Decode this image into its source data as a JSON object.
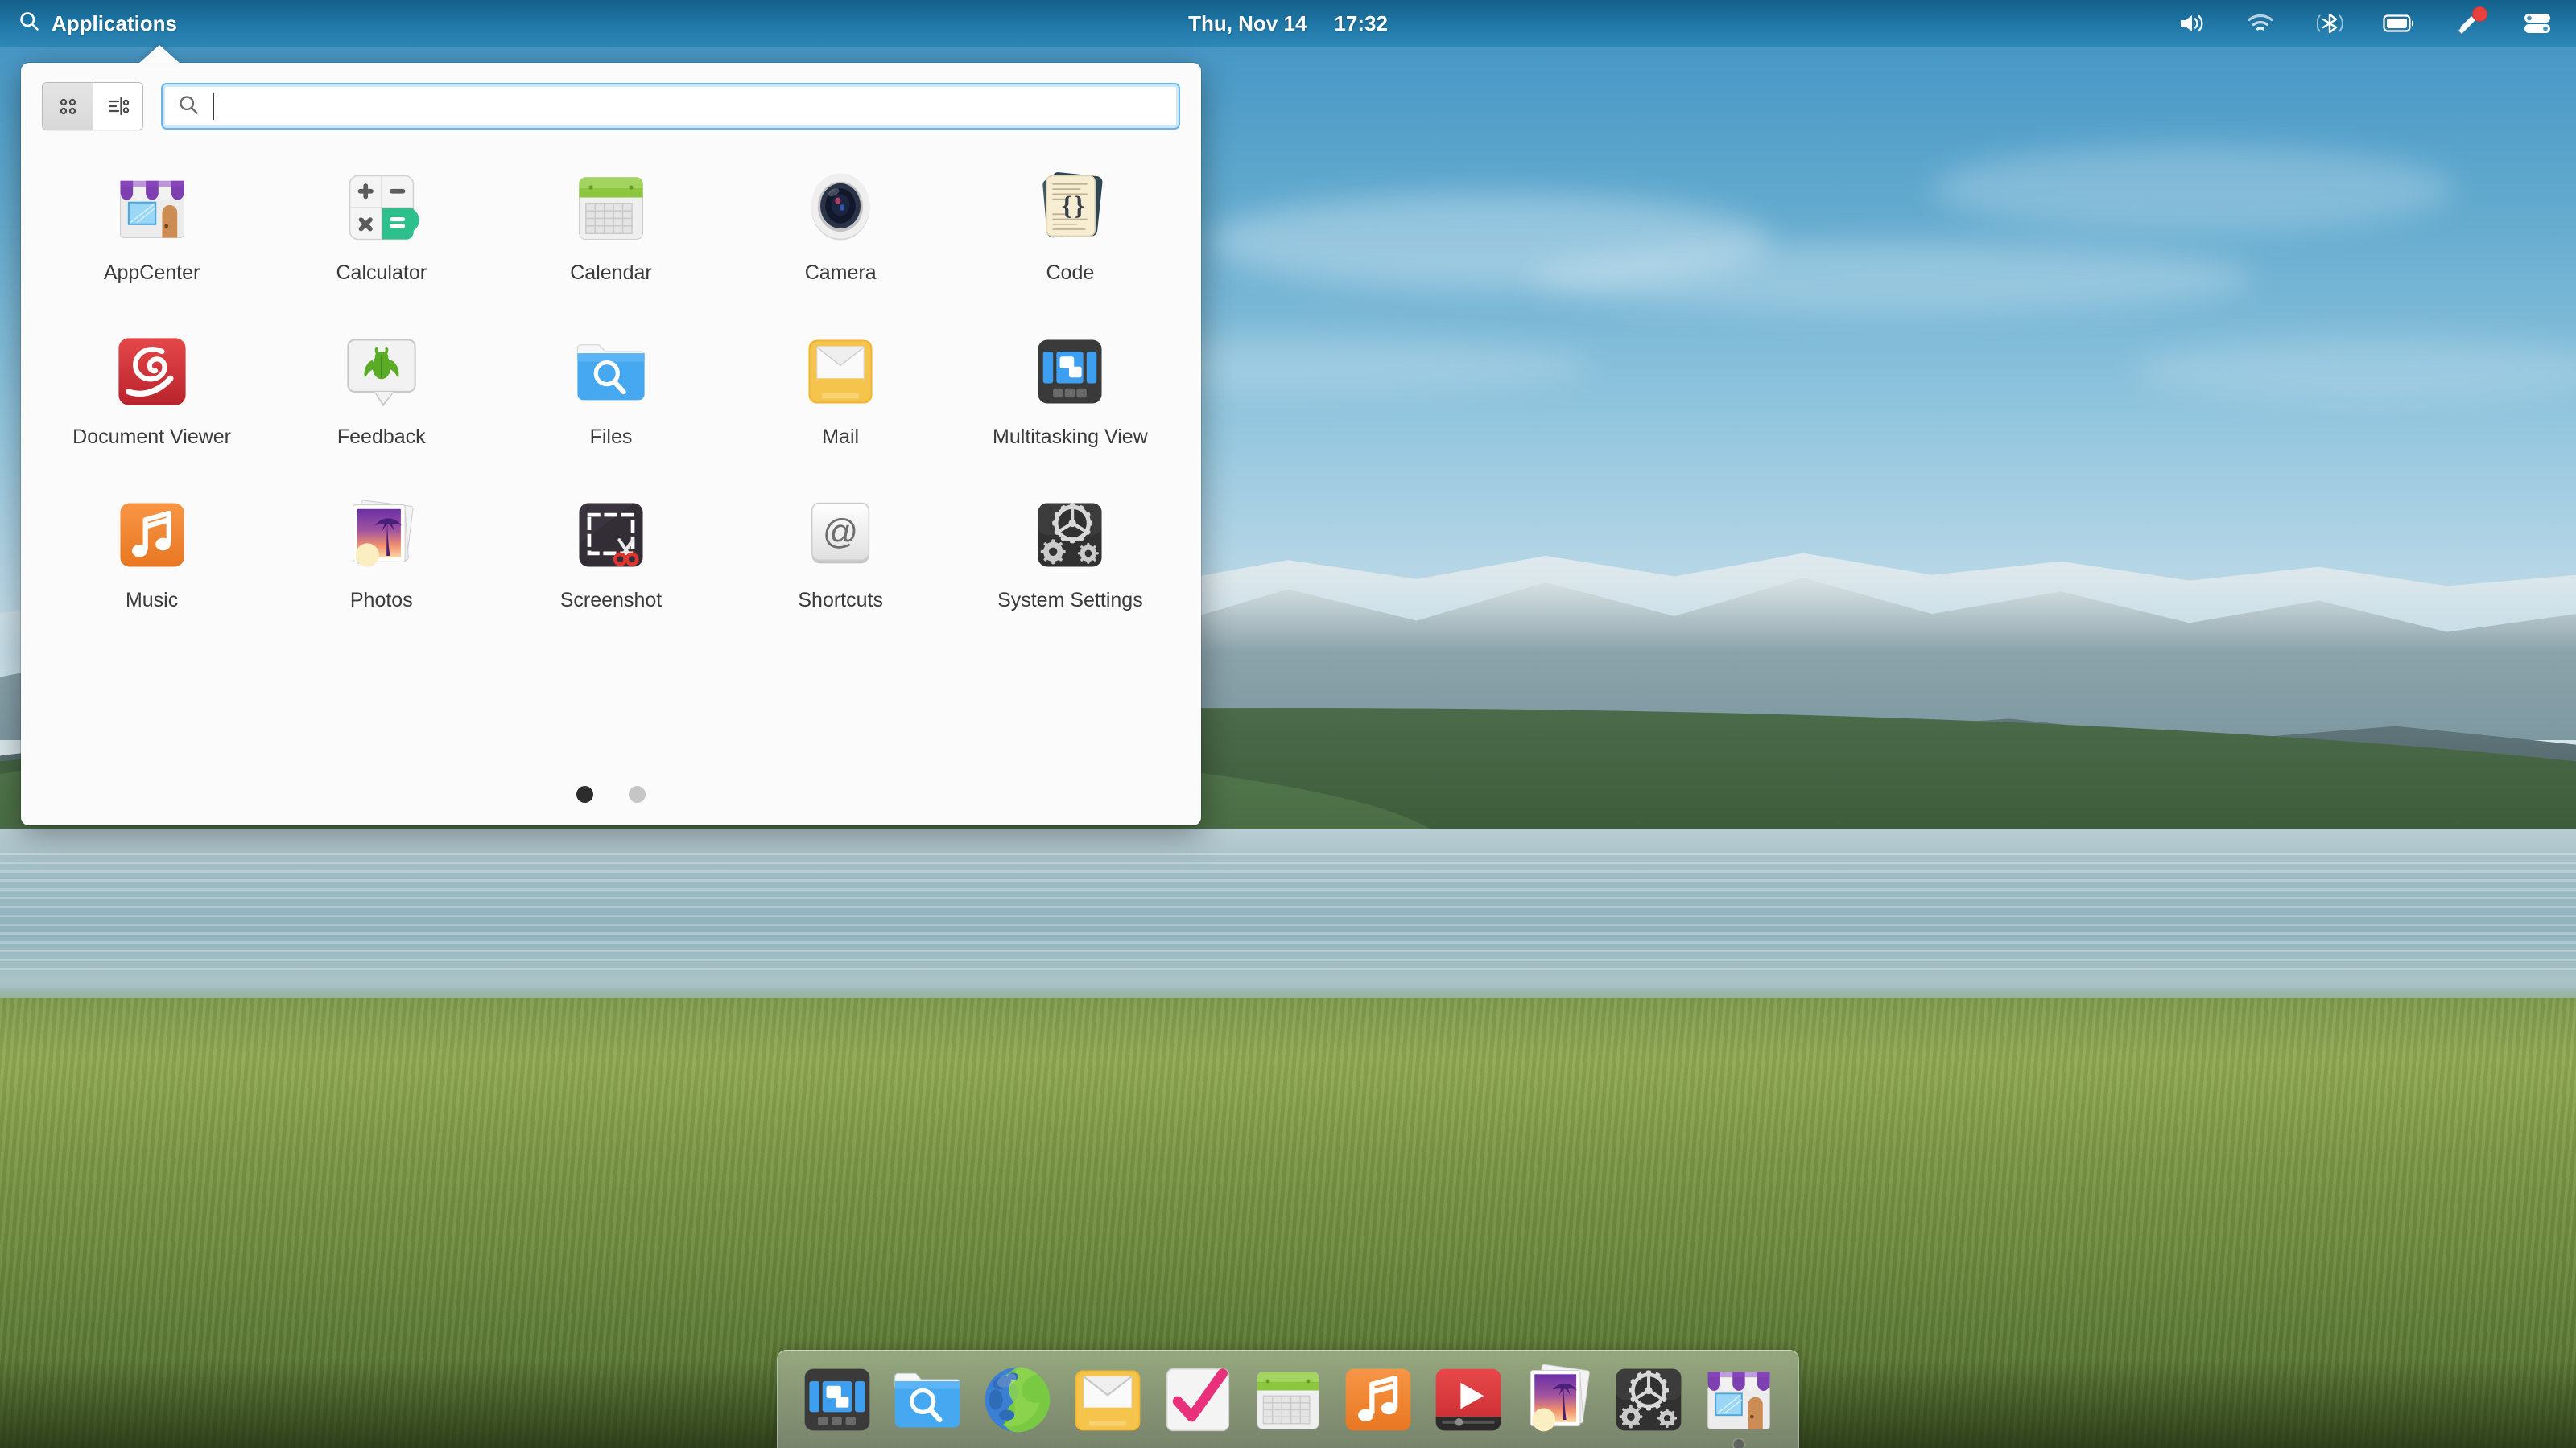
{
  "panel": {
    "applications_label": "Applications",
    "applications_icon": "search-icon",
    "clock_date": "Thu, Nov 14",
    "clock_time": "17:32",
    "tray": [
      {
        "name": "volume-icon",
        "label": "Sound"
      },
      {
        "name": "wifi-icon",
        "label": "Network"
      },
      {
        "name": "bluetooth-icon",
        "label": "Bluetooth"
      },
      {
        "name": "battery-icon",
        "label": "Power"
      },
      {
        "name": "notification-bell-icon",
        "label": "Notifications",
        "badge": true
      },
      {
        "name": "system-toggles-icon",
        "label": "System"
      }
    ]
  },
  "launcher": {
    "view_grid_label": "Grid View",
    "view_list_label": "List View",
    "search": {
      "placeholder": "",
      "value": "",
      "icon": "search-icon"
    },
    "apps": [
      {
        "name": "AppCenter",
        "icon": "appcenter-icon"
      },
      {
        "name": "Calculator",
        "icon": "calculator-icon"
      },
      {
        "name": "Calendar",
        "icon": "calendar-icon"
      },
      {
        "name": "Camera",
        "icon": "camera-icon"
      },
      {
        "name": "Code",
        "icon": "code-icon"
      },
      {
        "name": "Document Viewer",
        "icon": "document-viewer-icon"
      },
      {
        "name": "Feedback",
        "icon": "feedback-icon"
      },
      {
        "name": "Files",
        "icon": "files-icon"
      },
      {
        "name": "Mail",
        "icon": "mail-icon"
      },
      {
        "name": "Multitasking View",
        "icon": "multitasking-view-icon"
      },
      {
        "name": "Music",
        "icon": "music-icon"
      },
      {
        "name": "Photos",
        "icon": "photos-icon"
      },
      {
        "name": "Screenshot",
        "icon": "screenshot-icon"
      },
      {
        "name": "Shortcuts",
        "icon": "shortcuts-icon"
      },
      {
        "name": "System Settings",
        "icon": "system-settings-icon"
      }
    ],
    "pages": {
      "count": 2,
      "active": 1
    }
  },
  "dock": {
    "items": [
      {
        "name": "Multitasking View",
        "icon": "multitasking-view-icon",
        "running": false
      },
      {
        "name": "Files",
        "icon": "files-icon",
        "running": false
      },
      {
        "name": "Web",
        "icon": "web-icon",
        "running": false
      },
      {
        "name": "Mail",
        "icon": "mail-icon",
        "running": false
      },
      {
        "name": "Tasks",
        "icon": "tasks-icon",
        "running": false
      },
      {
        "name": "Calendar",
        "icon": "calendar-icon",
        "running": false
      },
      {
        "name": "Music",
        "icon": "music-icon",
        "running": false
      },
      {
        "name": "Videos",
        "icon": "videos-icon",
        "running": false
      },
      {
        "name": "Photos",
        "icon": "photos-icon",
        "running": false
      },
      {
        "name": "System Settings",
        "icon": "system-settings-icon",
        "running": false
      },
      {
        "name": "AppCenter",
        "icon": "appcenter-icon",
        "running": true
      }
    ]
  },
  "colors": {
    "panel": "#1b74a3",
    "accent_blue": "#69b4e8",
    "badge_red": "#e8413c",
    "launcher_bg": "#fbfbfb"
  },
  "wallpaper": {
    "description": "Mountain lake with grassy meadow"
  }
}
